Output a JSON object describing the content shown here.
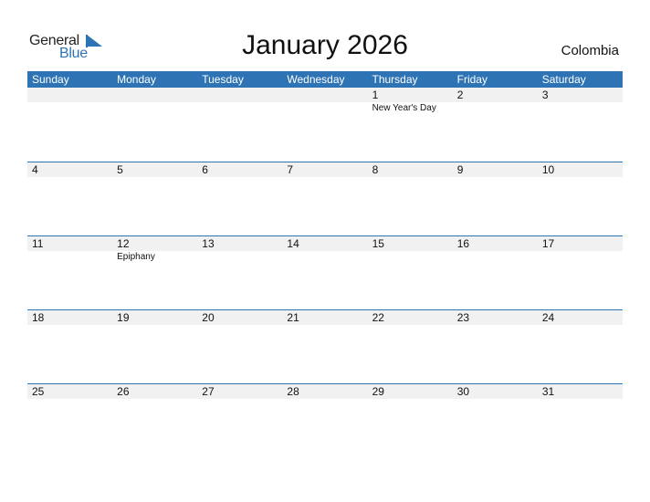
{
  "logo": {
    "line1": "General",
    "line2": "Blue"
  },
  "title": "January 2026",
  "country": "Colombia",
  "colors": {
    "accent": "#2e74b5",
    "date_strip": "#f1f1f1"
  },
  "weekdays": [
    "Sunday",
    "Monday",
    "Tuesday",
    "Wednesday",
    "Thursday",
    "Friday",
    "Saturday"
  ],
  "weeks": [
    [
      {
        "d": ""
      },
      {
        "d": ""
      },
      {
        "d": ""
      },
      {
        "d": ""
      },
      {
        "d": "1",
        "e": "New Year's Day"
      },
      {
        "d": "2"
      },
      {
        "d": "3"
      }
    ],
    [
      {
        "d": "4"
      },
      {
        "d": "5"
      },
      {
        "d": "6"
      },
      {
        "d": "7"
      },
      {
        "d": "8"
      },
      {
        "d": "9"
      },
      {
        "d": "10"
      }
    ],
    [
      {
        "d": "11"
      },
      {
        "d": "12",
        "e": "Epiphany"
      },
      {
        "d": "13"
      },
      {
        "d": "14"
      },
      {
        "d": "15"
      },
      {
        "d": "16"
      },
      {
        "d": "17"
      }
    ],
    [
      {
        "d": "18"
      },
      {
        "d": "19"
      },
      {
        "d": "20"
      },
      {
        "d": "21"
      },
      {
        "d": "22"
      },
      {
        "d": "23"
      },
      {
        "d": "24"
      }
    ],
    [
      {
        "d": "25"
      },
      {
        "d": "26"
      },
      {
        "d": "27"
      },
      {
        "d": "28"
      },
      {
        "d": "29"
      },
      {
        "d": "30"
      },
      {
        "d": "31"
      }
    ]
  ]
}
